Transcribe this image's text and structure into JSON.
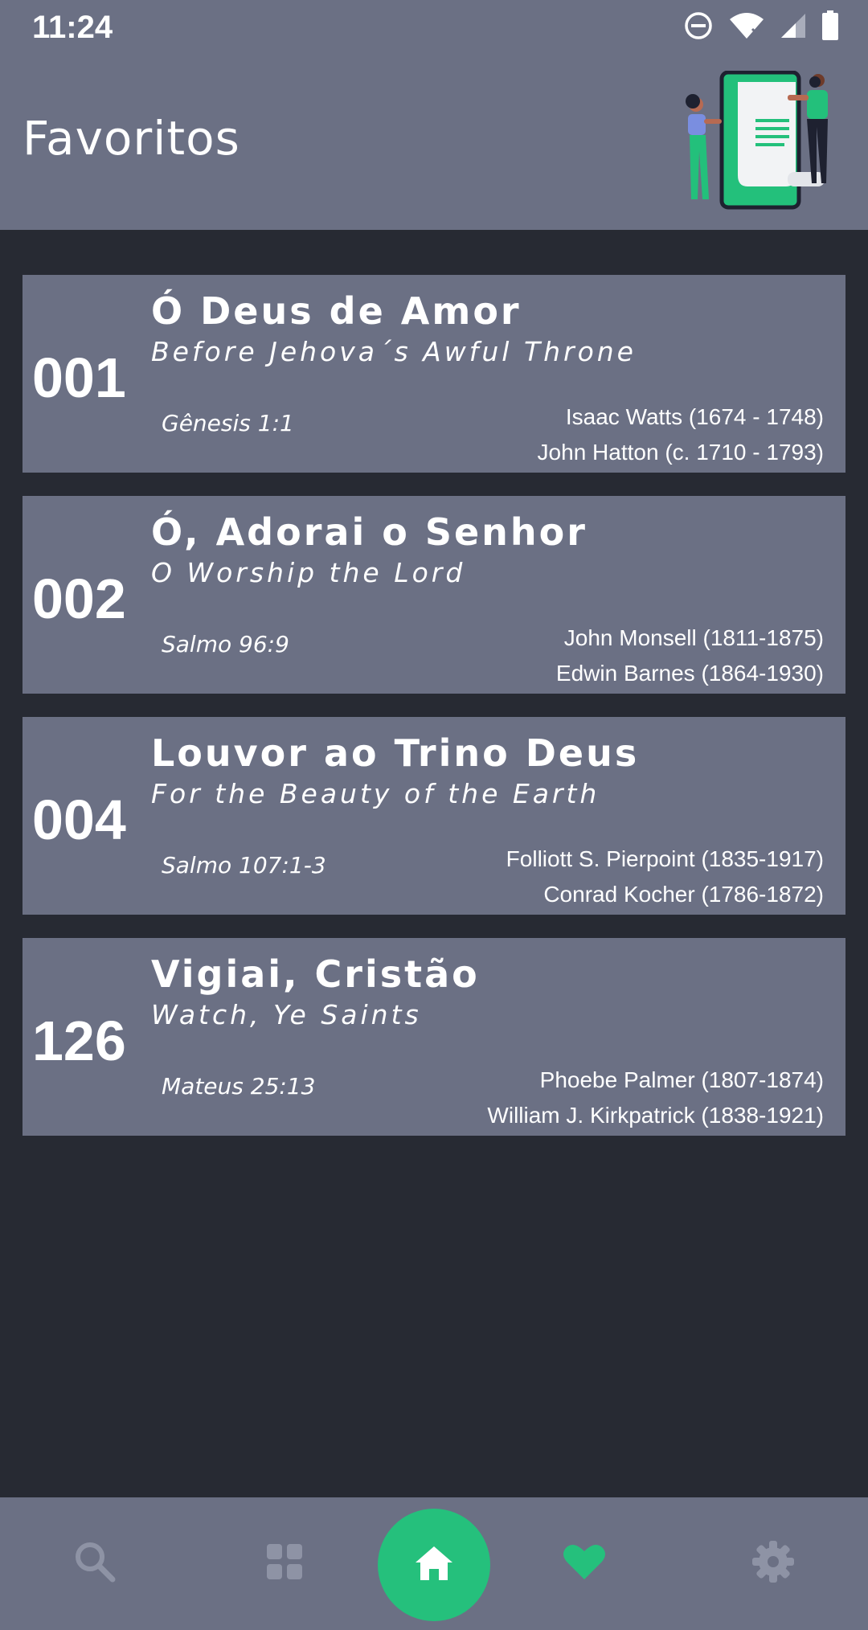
{
  "status_bar": {
    "time": "11:24"
  },
  "header": {
    "title": "Favoritos"
  },
  "hymns": [
    {
      "number": "001",
      "title": "Ó Deus de Amor",
      "subtitle": "Before Jehova´s Awful Throne",
      "reference": "Gênesis 1:1",
      "author_1": "Isaac Watts (1674 - 1748)",
      "author_2": "John Hatton (c. 1710 - 1793)"
    },
    {
      "number": "002",
      "title": "Ó, Adorai o Senhor",
      "subtitle": "O Worship the Lord",
      "reference": "Salmo 96:9",
      "author_1": "John Monsell (1811-1875)",
      "author_2": "Edwin Barnes (1864-1930)"
    },
    {
      "number": "004",
      "title": "Louvor ao Trino Deus",
      "subtitle": "For the Beauty of the Earth",
      "reference": "Salmo 107:1-3",
      "author_1": "Folliott S. Pierpoint (1835-1917)",
      "author_2": "Conrad Kocher (1786-1872)"
    },
    {
      "number": "126",
      "title": "Vigiai, Cristão",
      "subtitle": "Watch, Ye Saints",
      "reference": "Mateus 25:13",
      "author_1": "Phoebe Palmer (1807-1874)",
      "author_2": "William J. Kirkpatrick (1838-1921)"
    }
  ],
  "bottom_nav": {
    "items": [
      {
        "icon": "search-icon",
        "active": false
      },
      {
        "icon": "grid-icon",
        "active": false
      },
      {
        "icon": "home-icon",
        "active": false
      },
      {
        "icon": "heart-icon",
        "active": true
      },
      {
        "icon": "gear-icon",
        "active": false
      }
    ]
  },
  "colors": {
    "background": "#272a33",
    "surface": "#6b7084",
    "accent": "#25c07c",
    "inactive_icon": "#8e93a5",
    "text": "#ffffff"
  }
}
